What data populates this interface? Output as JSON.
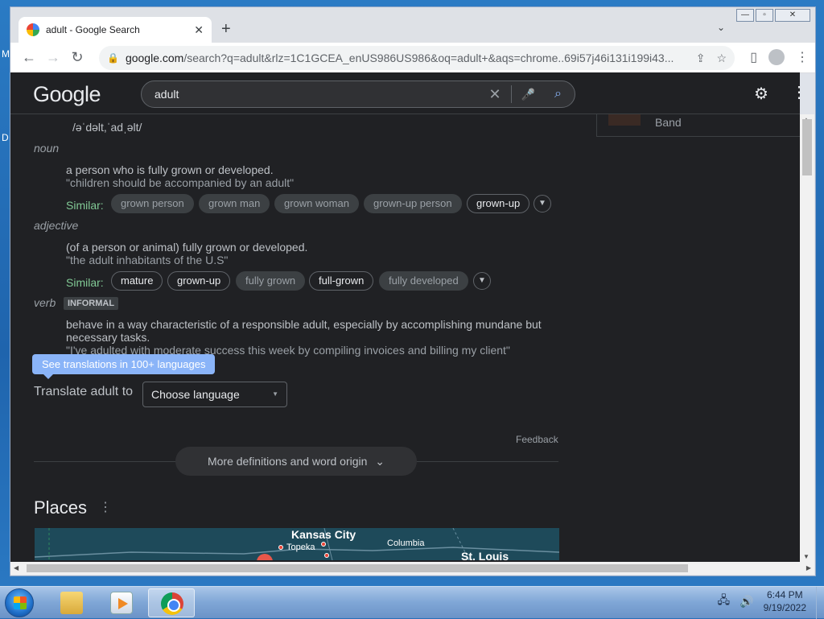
{
  "desktop": {
    "letter_m": "M",
    "letter_d": "D"
  },
  "browser": {
    "tab_title": "adult - Google Search",
    "tab_close": "✕",
    "new_tab": "+",
    "tab_search": "⌄",
    "window_controls": {
      "minimize": "—",
      "maximize": "▫",
      "close": "✕"
    },
    "url_main": "google.com",
    "url_rest": "/search?q=adult&rlz=1C1GCEA_enUS986US986&oq=adult+&aqs=chrome..69i57j46i131i199i43...",
    "back": "←",
    "forward": "→",
    "reload": "↻"
  },
  "google": {
    "logo": "Google",
    "query": "adult",
    "clear": "✕",
    "settings": "⚙",
    "more": "⋮",
    "side_text": "Band"
  },
  "dictionary": {
    "pronunciation": "/əˈdəlt,ˈadˌəlt/",
    "noun": {
      "pos": "noun",
      "definition": "a person who is fully grown or developed.",
      "example": "\"children should be accompanied by an adult\"",
      "similar_label": "Similar:",
      "chips": [
        {
          "label": "grown person"
        },
        {
          "label": "grown man"
        },
        {
          "label": "grown woman"
        },
        {
          "label": "grown-up person"
        },
        {
          "label": "grown-up"
        }
      ]
    },
    "adjective": {
      "pos": "adjective",
      "definition": "(of a person or animal) fully grown or developed.",
      "example": "\"the adult inhabitants of the U.S\"",
      "similar_label": "Similar:",
      "chips": [
        {
          "label": "mature"
        },
        {
          "label": "grown-up"
        },
        {
          "label": "fully grown"
        },
        {
          "label": "full-grown"
        },
        {
          "label": "fully developed"
        }
      ]
    },
    "verb": {
      "pos": "verb",
      "badge": "INFORMAL",
      "definition_1": "behave in a way characteristic of a responsible adult, especially by accomplishing mundane but",
      "definition_2": "necessary tasks.",
      "example": "\"I've adulted with moderate success this week by compiling invoices and billing my client\""
    },
    "tooltip": "See translations in 100+ languages",
    "translate_label": "Translate adult to",
    "choose_language": "Choose language",
    "feedback": "Feedback",
    "more_definitions": "More definitions and word origin"
  },
  "places": {
    "title": "Places",
    "labels": {
      "kansas_city": "Kansas City",
      "topeka": "Topeka",
      "columbia": "Columbia",
      "st_louis": "St. Louis"
    }
  },
  "taskbar": {
    "time": "6:44 PM",
    "date": "9/19/2022"
  }
}
